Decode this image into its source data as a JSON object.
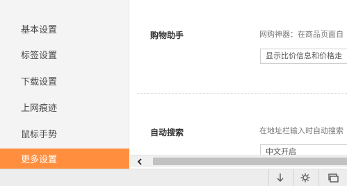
{
  "sidebar": {
    "items": [
      {
        "label": "基本设置",
        "active": false
      },
      {
        "label": "标签设置",
        "active": false
      },
      {
        "label": "下载设置",
        "active": false
      },
      {
        "label": "上网痕迹",
        "active": false
      },
      {
        "label": "鼠标手势",
        "active": false
      },
      {
        "label": "更多设置",
        "active": true
      }
    ]
  },
  "main": {
    "shopping": {
      "title": "购物助手",
      "description": "网购神器：在商品页面自",
      "select_value": "显示比价信息和价格走"
    },
    "autosearch": {
      "title": "自动搜索",
      "description": "在地址栏输入时自动搜索",
      "select_value": "中文开启"
    }
  },
  "scrollbar": {
    "left_arrow_icon": "chevron-left-icon"
  },
  "bottombar": {
    "icons": [
      "download-icon",
      "gear-icon",
      "window-icon"
    ]
  },
  "colors": {
    "accent": "#ff8f3f",
    "sidebar_bg": "#f4f4f4"
  }
}
